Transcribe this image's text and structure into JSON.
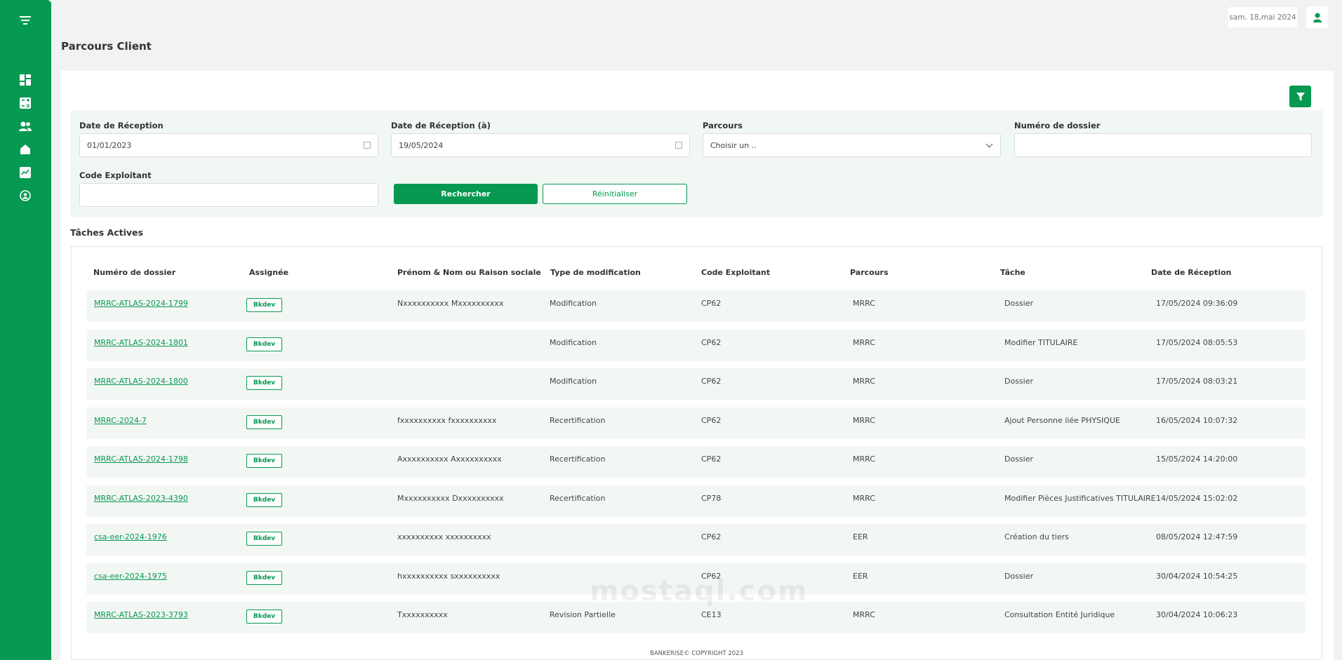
{
  "header": {
    "date": "sam. 18,mai 2024",
    "page_title": "Parcours Client"
  },
  "filters": {
    "date_from_label": "Date de Réception",
    "date_from_value": "01/01/2023",
    "date_to_label": "Date de Réception (à)",
    "date_to_value": "19/05/2024",
    "parcours_label": "Parcours",
    "parcours_value": "Choisir un ..",
    "dossier_label": "Numéro de dossier",
    "dossier_value": "",
    "exploitant_label": "Code Exploitant",
    "exploitant_value": "",
    "search_label": "Rechercher",
    "reset_label": "Réinitialiser"
  },
  "tasks": {
    "title": "Tâches Actives",
    "columns": [
      "Numéro de dossier",
      "Assignée",
      "Prénom & Nom ou Raison sociale",
      "Type de modification",
      "Code Exploitant",
      "Parcours",
      "Tâche",
      "Date de Réception"
    ],
    "rows": [
      [
        "MRRC-ATLAS-2024-1799",
        "Bkdev",
        "Nxxxxxxxxxx Mxxxxxxxxxx",
        "Modification",
        "CP62",
        "MRRC",
        "Dossier",
        "17/05/2024 09:36:09"
      ],
      [
        "MRRC-ATLAS-2024-1801",
        "Bkdev",
        "",
        "Modification",
        "CP62",
        "MRRC",
        "Modifier TITULAIRE",
        "17/05/2024 08:05:53"
      ],
      [
        "MRRC-ATLAS-2024-1800",
        "Bkdev",
        "",
        "Modification",
        "CP62",
        "MRRC",
        "Dossier",
        "17/05/2024 08:03:21"
      ],
      [
        "MRRC-2024-7",
        "Bkdev",
        "fxxxxxxxxxx fxxxxxxxxxx",
        "Recertification",
        "CP62",
        "MRRC",
        "Ajout Personne liée PHYSIQUE",
        "16/05/2024 10:07:32"
      ],
      [
        "MRRC-ATLAS-2024-1798",
        "Bkdev",
        "Axxxxxxxxxx Axxxxxxxxxx",
        "Recertification",
        "CP62",
        "MRRC",
        "Dossier",
        "15/05/2024 14:20:00"
      ],
      [
        "MRRC-ATLAS-2023-4390",
        "Bkdev",
        "Mxxxxxxxxxx Dxxxxxxxxxx",
        "Recertification",
        "CP78",
        "MRRC",
        "Modifier Pièces Justificatives TITULAIRE",
        "14/05/2024 15:02:02"
      ],
      [
        "csa-eer-2024-1976",
        "Bkdev",
        "xxxxxxxxxx xxxxxxxxxx",
        "",
        "CP62",
        "EER",
        "Création du tiers",
        "08/05/2024 12:47:59"
      ],
      [
        "csa-eer-2024-1975",
        "Bkdev",
        "hxxxxxxxxxx sxxxxxxxxxx",
        "",
        "CP62",
        "EER",
        "Dossier",
        "30/04/2024 10:54:25"
      ],
      [
        "MRRC-ATLAS-2023-3793",
        "Bkdev",
        "Txxxxxxxxxx",
        "Revision Partielle",
        "CE13",
        "MRRC",
        "Consultation Entité Juridique",
        "30/04/2024 10:06:23"
      ]
    ]
  },
  "footer": {
    "text": "BANKERISE© COPYRIGHT 2023"
  },
  "watermark": {
    "text": "mostaql.com"
  },
  "colors": {
    "brand": "#069952",
    "page_bg": "#f1f2f3",
    "row_bg": "#f3f7f4"
  }
}
